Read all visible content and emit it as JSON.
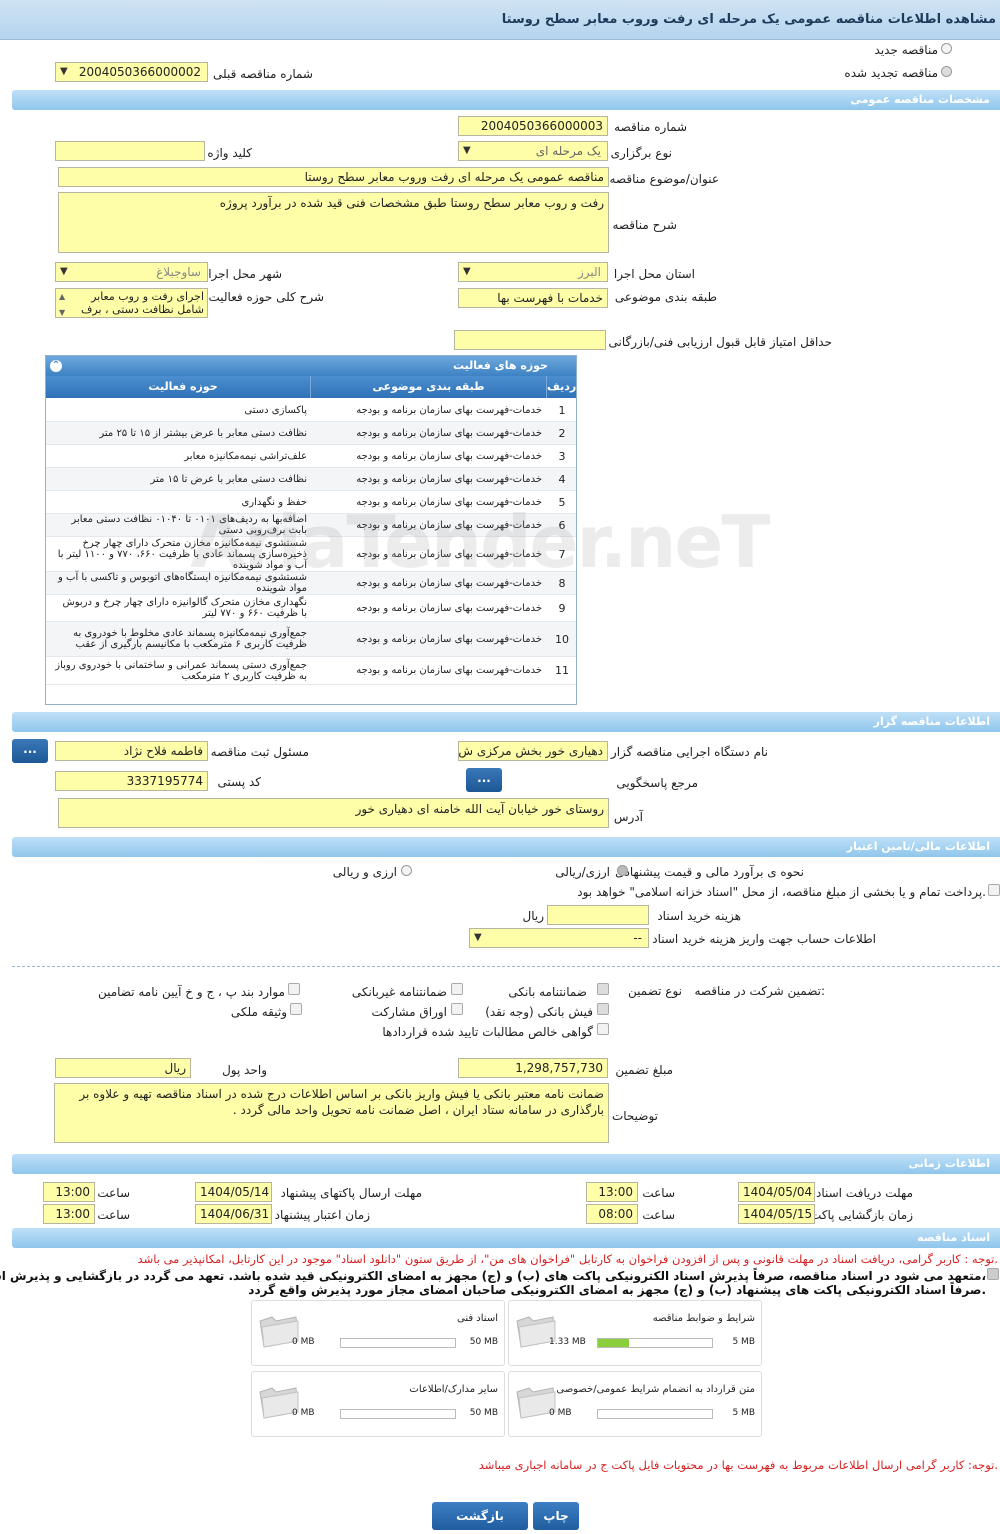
{
  "header": {
    "title": "مشاهده اطلاعات مناقصه عمومی یک مرحله ای رفت وروب معابر سطح روستا"
  },
  "top": {
    "new_tender": "مناقصه جدید",
    "renewed_tender": "مناقصه تجدید شده",
    "prev_number_label": "شماره مناقصه قبلی",
    "prev_number_value": "2004050366000002"
  },
  "sections": {
    "general": "مشخصات مناقصه عمومی",
    "organizer": "اطلاعات مناقصه گزار",
    "financial": "اطلاعات مالی/تامین اعتبار",
    "timing": "اطلاعات زمانی",
    "docs": "اسناد مناقصه"
  },
  "general": {
    "number_label": "شماره مناقصه",
    "number_value": "2004050366000003",
    "type_label": "نوع برگزاری",
    "type_value": "یک مرحله ای",
    "keyword_label": "کلید واژه",
    "keyword_value": "",
    "subject_label": "عنوان/موضوع مناقصه",
    "subject_value": "مناقصه عمومی یک مرحله ای رفت وروب معابر سطح روستا",
    "desc_label": "شرح مناقصه",
    "desc_value": "رفت و روب معابر سطح روستا طبق مشخصات فنی قید شده در برآورد پروژه",
    "province_label": "استان محل اجرا",
    "province_value": "البرز",
    "city_label": "شهر محل اجرا",
    "city_value": "ساوجبلاغ",
    "category_label": "طبقه بندی موضوعی",
    "category_value": "خدمات با فهرست بها",
    "activity_desc_label": "شرح کلی حوزه فعالیت",
    "activity_desc_value": "اجرای رفت و روب  معابر شامل نظافت دستی ، برف",
    "min_score_label": "حداقل امتیاز قابل قبول ارزیابی فنی/بازرگانی",
    "min_score_value": ""
  },
  "activities": {
    "title": "حوزه های فعالیت",
    "col_idx": "ردیف",
    "col_cat": "طبقه بندی موضوعی",
    "col_act": "حوزه فعالیت",
    "rows": [
      {
        "idx": "1",
        "cat": "خدمات-فهرست بهای سازمان برنامه و بودجه",
        "act": "پاکسازی دستی"
      },
      {
        "idx": "2",
        "cat": "خدمات-فهرست بهای سازمان برنامه و بودجه",
        "act": "نظافت دستی معابر با عرض بیشتر از ۱۵ تا ۲۵ متر"
      },
      {
        "idx": "3",
        "cat": "خدمات-فهرست بهای سازمان برنامه و بودجه",
        "act": "علف‌تراشی نیمه‌مکانیزه معابر"
      },
      {
        "idx": "4",
        "cat": "خدمات-فهرست بهای سازمان برنامه و بودجه",
        "act": "نظافت دستی معابر با عرض تا ۱۵ متر"
      },
      {
        "idx": "5",
        "cat": "خدمات-فهرست بهای سازمان برنامه و بودجه",
        "act": "حفظ و نگهداری"
      },
      {
        "idx": "6",
        "cat": "خدمات-فهرست بهای سازمان برنامه و بودجه",
        "act": "اضافه‌بها به ردیف‌های ۰۱۰۱ تا ۰۱۰۴۰ نظافت دستی معابر بابت برف‌روبی دستی"
      },
      {
        "idx": "7",
        "cat": "خدمات-فهرست بهای سازمان برنامه و بودجه",
        "act": "شستشوی نیمه‌مکانیزه مخازن متحرک دارای چهار چرخ ذخیره‌سازی پسماند عادی با ظرفیت ۶۶۰، ۷۷۰ و ۱۱۰۰ لیتر با آب و مواد شوینده"
      },
      {
        "idx": "8",
        "cat": "خدمات-فهرست بهای سازمان برنامه و بودجه",
        "act": "شستشوی نیمه‌مکانیزه ایستگاه‌های اتوبوس و تاکسی با آب و مواد شوینده"
      },
      {
        "idx": "9",
        "cat": "خدمات-فهرست بهای سازمان برنامه و بودجه",
        "act": "نگهداری مخازن متحرک گالوانیزه دارای چهار چرخ و دربوش با ظرفیت ۶۶۰ و ۷۷۰ لیتر"
      },
      {
        "idx": "10",
        "cat": "خدمات-فهرست بهای سازمان برنامه و بودجه",
        "act": "جمع‌آوری نیمه‌مکانیزه پسماند عادی مخلوط با خودروی به ظرفیت کاربری ۶ مترمکعب با مکانیسم بارگیری از عقب"
      },
      {
        "idx": "11",
        "cat": "خدمات-فهرست بهای سازمان برنامه و بودجه",
        "act": "جمع‌آوری دستی پسماند عمرانی و ساختمانی با خودروی روباز به ظرفیت کاربری ۲ مترمکعب"
      }
    ]
  },
  "watermark": "AriaTender.neT",
  "organizer": {
    "org_label": "نام دستگاه اجرایی مناقصه گزار",
    "org_value": "دهیاری خور بخش مرکزی ش",
    "resp_label": "مسئول ثبت مناقصه",
    "resp_value": "فاطمه فلاح نژاد",
    "ref_label": "مرجع پاسخگویی",
    "ref_btn": "...",
    "postal_label": "کد پستی",
    "postal_value": "3337195774",
    "address_label": "آدرس",
    "address_value": "روستای خور خیابان آیت الله خامنه ای دهیاری خور",
    "dots_btn": "..."
  },
  "financial": {
    "method_label": "نحوه ی برآورد مالی و قیمت پیشنهادی",
    "opt_rial": "ارزی/ریالی",
    "opt_fx": "ارزی و ریالی",
    "treasury_text": "پرداخت تمام و یا بخشی از مبلغ مناقصه، از محل \"اسناد خزانه اسلامی\" خواهد بود.",
    "doc_fee_label": "هزینه خرید اسناد",
    "doc_fee_unit": "ریال",
    "doc_fee_value": "",
    "account_label": "اطلاعات حساب جهت واریز هزینه خرید اسناد",
    "account_value": "--"
  },
  "guarantee": {
    "title": "تضمین شرکت در مناقصه:",
    "type_label": "نوع تضمین",
    "options": [
      "ضمانتنامه بانکی",
      "ضمانتنامه غیربانکی",
      "موارد بند پ ، ج و خ آیین نامه تضامین",
      "فیش بانکی (وجه نقد)",
      "اوراق مشارکت",
      "وثیقه ملکی",
      "گواهی خالص مطالبات تایید شده قراردادها"
    ],
    "amount_label": "مبلغ تضمین",
    "amount_value": "1,298,757,730",
    "currency_label": "واحد پول",
    "currency_value": "ریال",
    "notes_label": "توضیحات",
    "notes_value": "ضمانت نامه معتبر بانکی یا فیش واریز بانکی بر اساس اطلاعات درج شده در اسناد مناقصه تهیه و علاوه بر بارگذاری در سامانه ستاد ایران  ،  اصل ضمانت نامه تحویل واحد مالی گردد ."
  },
  "timing": {
    "receive_label": "مهلت دریافت اسناد",
    "receive_date": "1404/05/04",
    "receive_time": "13:00",
    "send_label": "مهلت ارسال پاکتهای پیشنهاد",
    "send_date": "1404/05/14",
    "send_time": "13:00",
    "open_label": "زمان بازگشایی پاکت ها",
    "open_date": "1404/05/15",
    "open_time": "08:00",
    "valid_label": "زمان اعتبار پیشنهاد",
    "valid_date": "1404/06/31",
    "valid_time": "13:00",
    "time_label": "ساعت"
  },
  "docs": {
    "note1": "توجه : کاربر گرامی، دریافت اسناد در مهلت قانونی و پس از افزودن فراخوان به کارتابل \"فراخوان های من\"، از طریق ستون \"دانلود اسناد\" موجود در این کارتابل، امکانپذیر می باشد.",
    "commit1": "متعهد می شود در اسناد مناقصه، صرفاً پذیرش اسناد الکترونیکی پاکت های (ب) و (ج) مجهز به امضای الکترونیکی قید شده باشد. تعهد می گردد در بازگشایی و پذیرش اسناد،",
    "commit2": "صرفاً اسناد الکترونیکی پاکت های پیشنهاد (ب) و (ج) مجهز به امضای الکترونیکی صاحبان امضای مجاز مورد پذیرش واقع گردد.",
    "files": [
      {
        "title": "شرایط و ضوابط مناقصه",
        "used": "1.33 MB",
        "max": "5 MB",
        "fraction": 0.27
      },
      {
        "title": "اسناد فنی",
        "used": "0 MB",
        "max": "50 MB",
        "fraction": 0
      },
      {
        "title": "متن قرارداد به انضمام شرایط عمومی/خصوصی",
        "used": "0 MB",
        "max": "5 MB",
        "fraction": 0
      },
      {
        "title": "سایر مدارک/اطلاعات",
        "used": "0 MB",
        "max": "50 MB",
        "fraction": 0
      }
    ],
    "note2": "توجه: کاربر گرامی ارسال اطلاعات مربوط به فهرست بها در محتویات فایل پاکت ج در سامانه اجباری میباشد."
  },
  "footer": {
    "print": "چاپ",
    "back": "بازگشت"
  },
  "colors": {
    "accent": "#3d82c4",
    "input_bg": "#fefea8",
    "note_red": "#d62020"
  }
}
